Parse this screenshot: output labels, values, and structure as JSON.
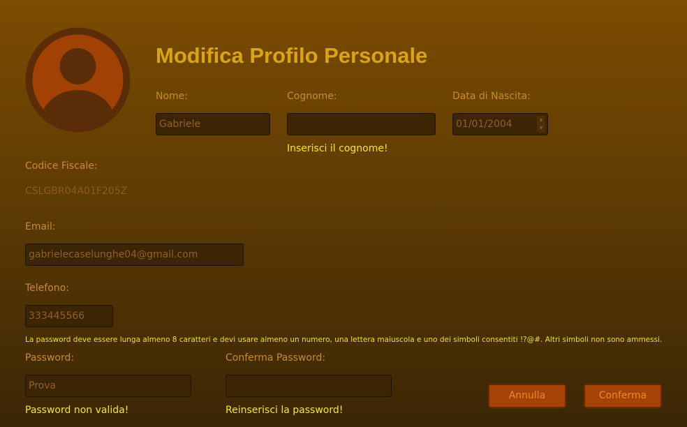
{
  "title": "Modifica Profilo Personale",
  "nome": {
    "label": "Nome:",
    "value": "Gabriele"
  },
  "cognome": {
    "label": "Cognome:",
    "value": "",
    "error": "Inserisci il cognome!"
  },
  "data_nascita": {
    "label": "Data di Nascita:",
    "value": "01/01/2004"
  },
  "codice_fiscale": {
    "label": "Codice Fiscale:",
    "value": "CSLGBR04A01F205Z"
  },
  "email": {
    "label": "Email:",
    "value": "gabrielecaselunghe04@gmail.com"
  },
  "telefono": {
    "label": "Telefono:",
    "value": "333445566"
  },
  "password_rules": "La password deve essere lunga almeno 8 caratteri e devi usare almeno un numero, una lettera maiuscola e uno dei simboli consentiti !?@#. Altri simboli non sono ammessi.",
  "password": {
    "label": "Password:",
    "value": "Prova",
    "error": "Password non valida!"
  },
  "conferma_password": {
    "label": "Conferma Password:",
    "value": "",
    "error": "Reinserisci la password!"
  },
  "buttons": {
    "cancel": "Annulla",
    "confirm": "Conferma"
  },
  "colors": {
    "accent": "#d9a416",
    "error": "#f5e630",
    "button": "#a54306"
  },
  "icons": {
    "avatar": "user-avatar-icon",
    "spinner_up": "▲",
    "spinner_down": "▼"
  }
}
